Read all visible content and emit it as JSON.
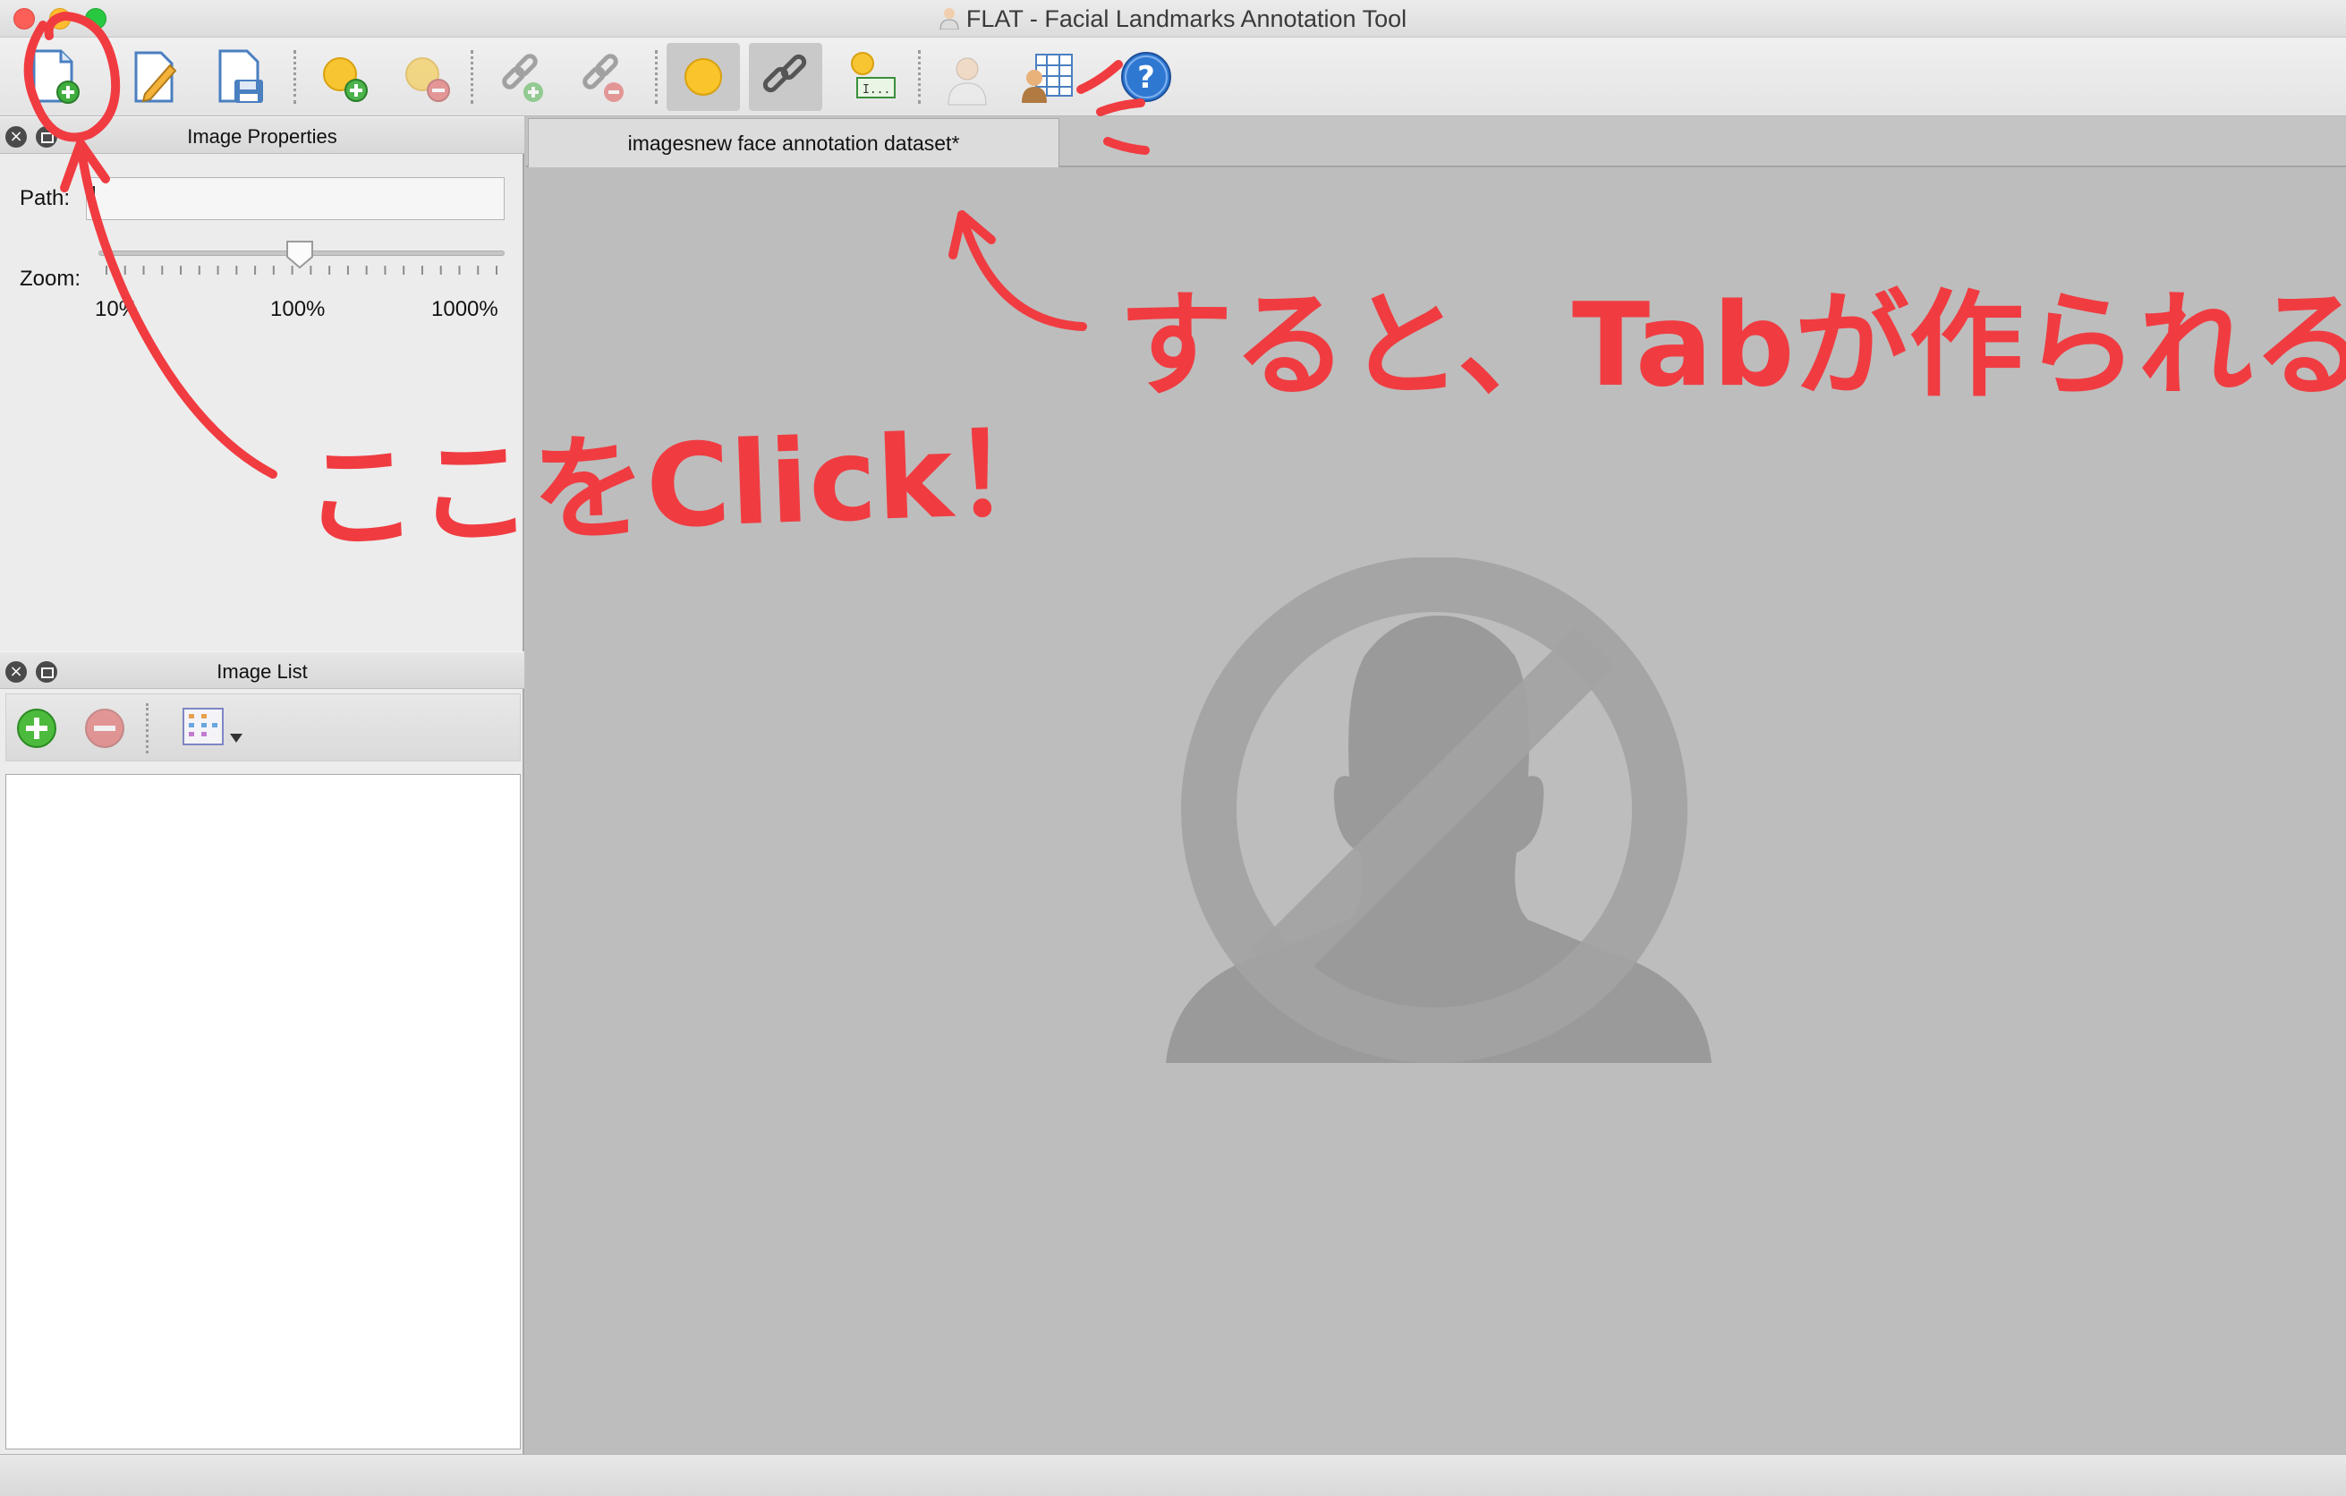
{
  "window": {
    "title": "FLAT - Facial Landmarks Annotation Tool"
  },
  "toolbar": {
    "buttons": [
      {
        "icon": "new-dataset-icon"
      },
      {
        "icon": "edit-dataset-icon"
      },
      {
        "icon": "save-dataset-icon"
      },
      {
        "icon": "add-landmark-icon"
      },
      {
        "icon": "remove-landmark-icon"
      },
      {
        "icon": "add-connection-icon"
      },
      {
        "icon": "remove-connection-icon"
      },
      {
        "icon": "show-landmarks-icon"
      },
      {
        "icon": "show-connections-icon"
      },
      {
        "icon": "show-landmark-ids-icon"
      },
      {
        "icon": "face-fit-icon"
      },
      {
        "icon": "properties-table-icon"
      },
      {
        "icon": "help-icon"
      }
    ]
  },
  "image_properties": {
    "title": "Image Properties",
    "path_label": "Path:",
    "path_value": "",
    "zoom_label": "Zoom:",
    "zoom_level": 100,
    "zoom_ticks": [
      "10%",
      "100%",
      "1000%"
    ]
  },
  "image_list": {
    "title": "Image List"
  },
  "tabs": [
    {
      "label": "imagesnew face annotation dataset*"
    }
  ],
  "annotations": {
    "click_here": "ここをClick！",
    "tab_created": "すると、Tabが作られる"
  },
  "colors": {
    "annotation_red": "#f03c41",
    "placeholder_gray": "#9a9a9a"
  }
}
